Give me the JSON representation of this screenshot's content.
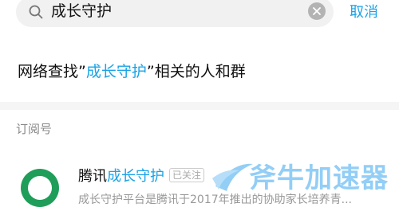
{
  "search": {
    "query": "成长守护",
    "cancel_label": "取消"
  },
  "network": {
    "prefix": "网络查找”",
    "highlight": "成长守护",
    "suffix": "”相关的人和群"
  },
  "section": {
    "title": "订阅号"
  },
  "account": {
    "name_prefix": "腾讯",
    "name_highlight": "成长守护",
    "badge": "已关注",
    "description": "成长守护平台是腾讯于2017年推出的协助家长培养青..."
  },
  "watermark": {
    "text": "斧牛加速器"
  },
  "colors": {
    "accent": "#1aa3e6",
    "avatar_green": "#1f9e5a"
  }
}
